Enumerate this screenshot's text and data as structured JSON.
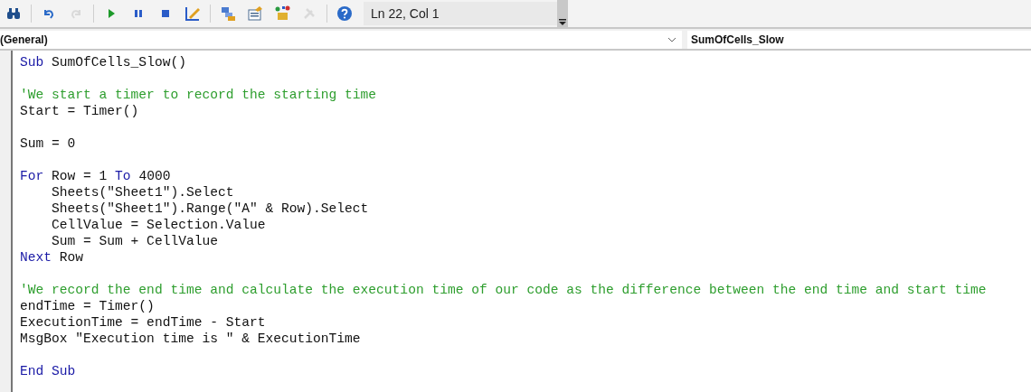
{
  "toolbar": {
    "buttons": [
      {
        "kind": "find",
        "disabled": false
      },
      {
        "kind": "sep"
      },
      {
        "kind": "undo",
        "disabled": false
      },
      {
        "kind": "redo",
        "disabled": true
      },
      {
        "kind": "sep"
      },
      {
        "kind": "run",
        "disabled": false
      },
      {
        "kind": "pause",
        "disabled": false
      },
      {
        "kind": "stop",
        "disabled": false
      },
      {
        "kind": "design",
        "disabled": false
      },
      {
        "kind": "sep"
      },
      {
        "kind": "project",
        "disabled": false
      },
      {
        "kind": "properties",
        "disabled": false
      },
      {
        "kind": "objects",
        "disabled": false
      },
      {
        "kind": "tools",
        "disabled": true
      },
      {
        "kind": "sep"
      },
      {
        "kind": "help",
        "disabled": false
      }
    ],
    "position": "Ln 22, Col 1"
  },
  "object_box": {
    "value": "(General)"
  },
  "procedure_box": {
    "value": "SumOfCells_Slow"
  },
  "code_lines": [
    {
      "kind": "code",
      "segments": [
        {
          "kind": "keyword",
          "text": "Sub"
        },
        {
          "kind": "plain",
          "text": " SumOfCells_Slow()"
        }
      ]
    },
    {
      "kind": "blank"
    },
    {
      "kind": "code",
      "segments": [
        {
          "kind": "comment",
          "text": "'We start a timer to record the starting time"
        }
      ]
    },
    {
      "kind": "code",
      "segments": [
        {
          "kind": "plain",
          "text": "Start = Timer()"
        }
      ]
    },
    {
      "kind": "blank"
    },
    {
      "kind": "code",
      "segments": [
        {
          "kind": "plain",
          "text": "Sum = 0"
        }
      ]
    },
    {
      "kind": "blank"
    },
    {
      "kind": "code",
      "segments": [
        {
          "kind": "keyword",
          "text": "For"
        },
        {
          "kind": "plain",
          "text": " Row = 1 "
        },
        {
          "kind": "keyword",
          "text": "To"
        },
        {
          "kind": "plain",
          "text": " 4000"
        }
      ]
    },
    {
      "kind": "code",
      "segments": [
        {
          "kind": "plain",
          "text": "    Sheets(\"Sheet1\").Select"
        }
      ]
    },
    {
      "kind": "code",
      "segments": [
        {
          "kind": "plain",
          "text": "    Sheets(\"Sheet1\").Range(\"A\" & Row).Select"
        }
      ]
    },
    {
      "kind": "code",
      "segments": [
        {
          "kind": "plain",
          "text": "    CellValue = Selection.Value"
        }
      ]
    },
    {
      "kind": "code",
      "segments": [
        {
          "kind": "plain",
          "text": "    Sum = Sum + CellValue"
        }
      ]
    },
    {
      "kind": "code",
      "segments": [
        {
          "kind": "keyword",
          "text": "Next"
        },
        {
          "kind": "plain",
          "text": " Row"
        }
      ]
    },
    {
      "kind": "blank"
    },
    {
      "kind": "code",
      "segments": [
        {
          "kind": "comment",
          "text": "'We record the end time and calculate the execution time of our code as the difference between the end time and start time"
        }
      ]
    },
    {
      "kind": "code",
      "segments": [
        {
          "kind": "plain",
          "text": "endTime = Timer()"
        }
      ]
    },
    {
      "kind": "code",
      "segments": [
        {
          "kind": "plain",
          "text": "ExecutionTime = endTime - Start"
        }
      ]
    },
    {
      "kind": "code",
      "segments": [
        {
          "kind": "plain",
          "text": "MsgBox \"Execution time is \" & ExecutionTime"
        }
      ]
    },
    {
      "kind": "blank"
    },
    {
      "kind": "code",
      "segments": [
        {
          "kind": "keyword",
          "text": "End Sub"
        }
      ]
    }
  ]
}
